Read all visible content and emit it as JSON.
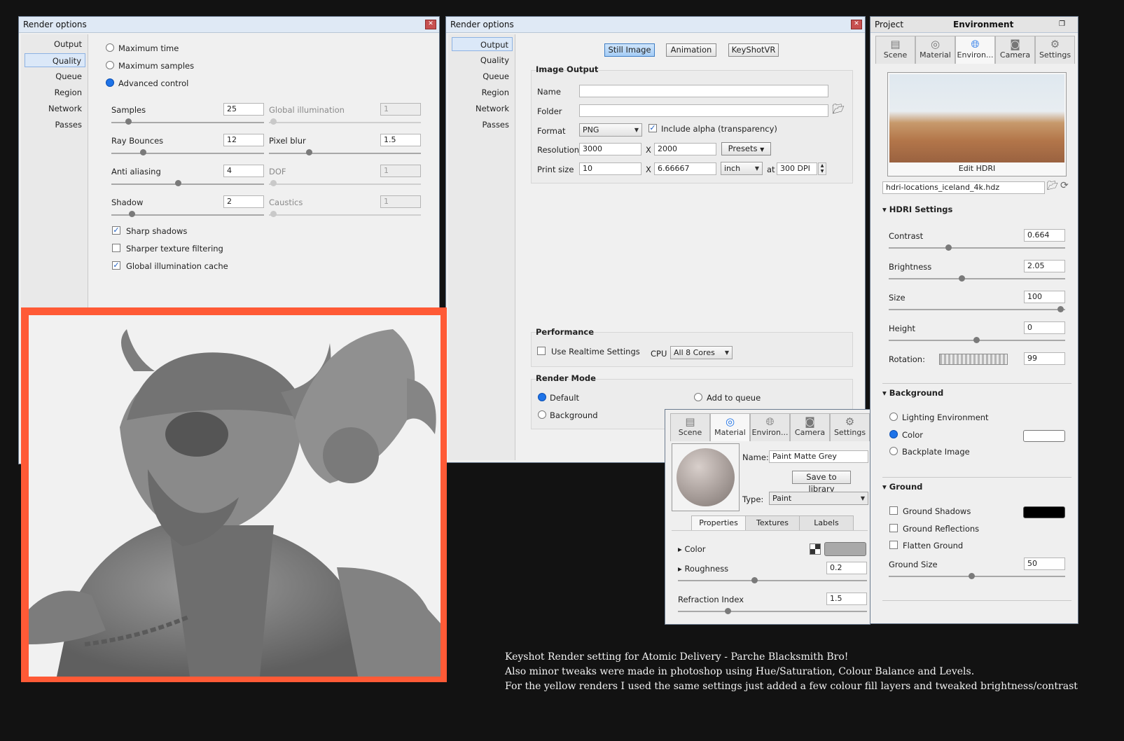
{
  "win1": {
    "title": "Render options",
    "nav": [
      "Output",
      "Quality",
      "Queue",
      "Region",
      "Network",
      "Passes"
    ],
    "modes": [
      "Maximum time",
      "Maximum samples",
      "Advanced control"
    ],
    "samples_label": "Samples",
    "samples_value": "25",
    "gi_label": "Global illumination",
    "gi_value": "1",
    "ray_label": "Ray Bounces",
    "ray_value": "12",
    "pixelblur_label": "Pixel blur",
    "pixelblur_value": "1.5",
    "aa_label": "Anti aliasing",
    "aa_value": "4",
    "dof_label": "DOF",
    "dof_value": "1",
    "shadow_label": "Shadow",
    "shadow_value": "2",
    "caustics_label": "Caustics",
    "caustics_value": "1",
    "sharp_shadows": "Sharp shadows",
    "sharper_texture": "Sharper texture filtering",
    "gi_cache": "Global illumination cache"
  },
  "win2": {
    "title": "Render options",
    "nav": [
      "Output",
      "Quality",
      "Queue",
      "Region",
      "Network",
      "Passes"
    ],
    "tabs": [
      "Still Image",
      "Animation",
      "KeyShotVR"
    ],
    "image_output": "Image Output",
    "name_label": "Name",
    "name_value": "",
    "folder_label": "Folder",
    "folder_value": "",
    "format_label": "Format",
    "format_value": "PNG",
    "alpha_label": "Include alpha (transparency)",
    "resolution_label": "Resolution",
    "res_w": "3000",
    "res_h": "2000",
    "x_sep": "X",
    "presets": "Presets",
    "print_label": "Print size",
    "print_w": "10",
    "print_h": "6.66667",
    "unit": "inch",
    "at": "at",
    "dpi": "300 DPI",
    "performance": "Performance",
    "realtime_label": "Use Realtime Settings",
    "cpu_label": "CPU",
    "cpu_value": "All 8 Cores",
    "render_mode": "Render Mode",
    "mode_default": "Default",
    "mode_queue": "Add to queue",
    "mode_background": "Background"
  },
  "project": {
    "title": "Project",
    "subtitle": "Environment",
    "tabs": [
      "Scene",
      "Material",
      "Environ...",
      "Camera",
      "Settings"
    ],
    "edit_hdri": "Edit HDRI",
    "hdri_file": "hdri-locations_iceland_4k.hdz",
    "hdri_settings": "HDRI Settings",
    "contrast_label": "Contrast",
    "contrast_value": "0.664",
    "brightness_label": "Brightness",
    "brightness_value": "2.05",
    "size_label": "Size",
    "size_value": "100",
    "height_label": "Height",
    "height_value": "0",
    "rotation_label": "Rotation:",
    "rotation_value": "99",
    "background": "Background",
    "bg_options": [
      "Lighting Environment",
      "Color",
      "Backplate Image"
    ],
    "ground": "Ground",
    "ground_shadows": "Ground Shadows",
    "ground_reflections": "Ground Reflections",
    "flatten_ground": "Flatten Ground",
    "ground_size_label": "Ground Size",
    "ground_size_value": "50"
  },
  "material": {
    "tabs": [
      "Scene",
      "Material",
      "Environ...",
      "Camera",
      "Settings"
    ],
    "name_label": "Name:",
    "name_value": "Paint Matte Grey",
    "save_btn": "Save to library",
    "type_label": "Type:",
    "type_value": "Paint",
    "subtabs": [
      "Properties",
      "Textures",
      "Labels"
    ],
    "color_label": "Color",
    "roughness_label": "Roughness",
    "roughness_value": "0.2",
    "refraction_label": "Refraction Index",
    "refraction_value": "1.5"
  },
  "caption": {
    "line1": "Keyshot Render setting for Atomic Delivery - Parche Blacksmith Bro!",
    "line2": "Also minor tweaks were made in photoshop using Hue/Saturation, Colour Balance and Levels.",
    "line3": "For the yellow renders I used the same settings just added a few colour fill layers and tweaked brightness/contrast"
  },
  "colors": {
    "accent": "#1e73e8",
    "frame": "#ff5a36",
    "background": "#121212"
  }
}
